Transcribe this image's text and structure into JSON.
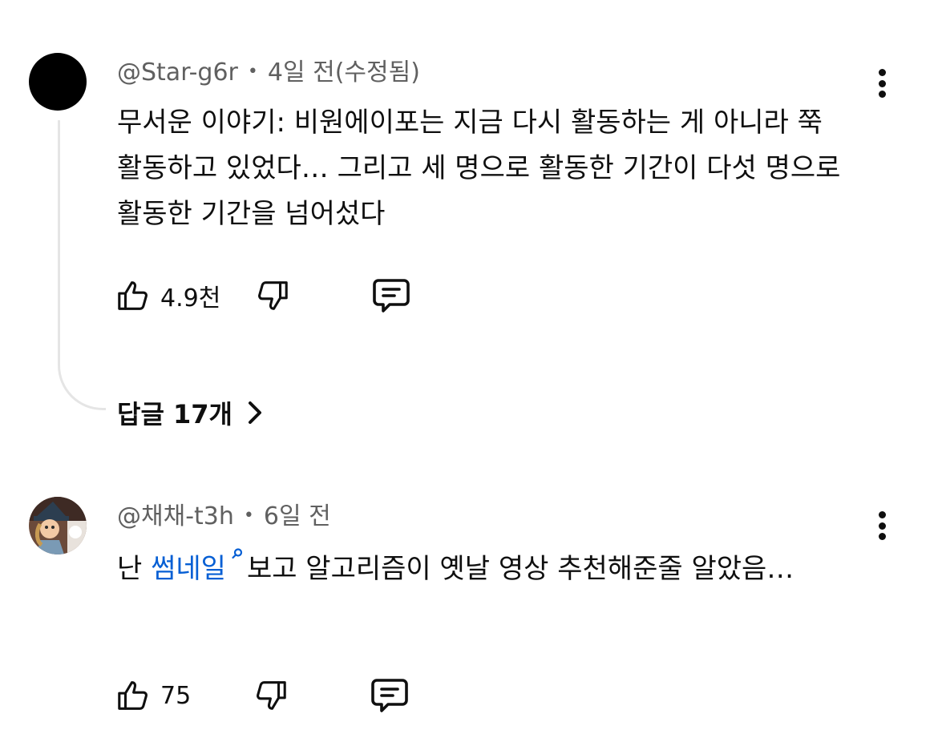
{
  "comments": [
    {
      "author": "@Star-g6r",
      "separator": "•",
      "time": "4일 전(수정됨)",
      "text": "무서운 이야기: 비원에이포는 지금 다시 활동하는 게 아니라 쭉 활동하고 있었다… 그리고 세 명으로 활동한 기간이 다섯 명으로 활동한 기간을 넘어섰다",
      "likes": "4.9천",
      "replies_label": "답글 17개",
      "avatar_color": "#000000"
    },
    {
      "author": "@채채-t3h",
      "separator": "•",
      "time": "6일 전",
      "text_before": "난 ",
      "link_text": "썸네일",
      "text_after": "보고 알고리즘이 옛날 영상 추천해준줄 알았음…",
      "likes": "75"
    }
  ],
  "icons": {
    "more": "more-vert-icon",
    "like": "thumbs-up-icon",
    "dislike": "thumbs-down-icon",
    "reply": "comment-icon",
    "chevron": "chevron-right-icon",
    "search": "search-icon"
  },
  "colors": {
    "text": "#0f0f0f",
    "meta": "#606060",
    "link": "#065fd4",
    "thread_line": "#e5e5e5"
  }
}
